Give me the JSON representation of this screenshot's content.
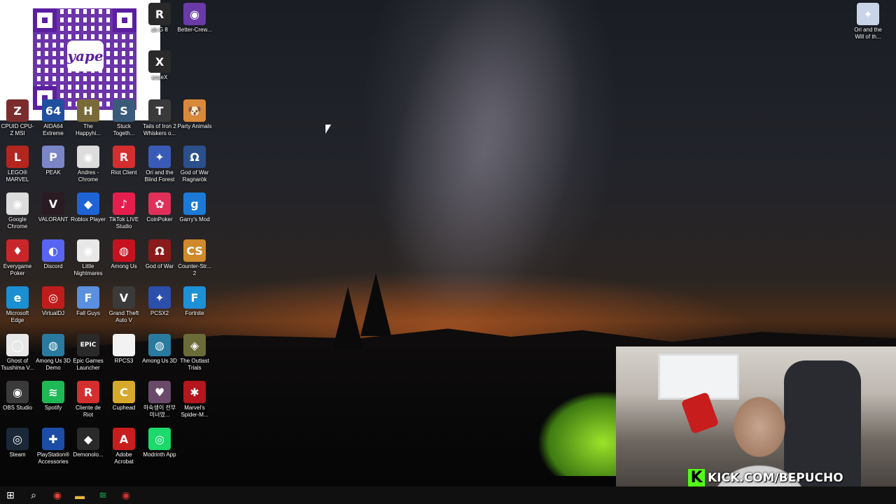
{
  "desktop": {
    "icons": [
      {
        "label": "CPUID CPU-Z MSI",
        "color": "#7b2c2c",
        "glyph": "Z",
        "x": 0,
        "y": 0
      },
      {
        "label": "AIDA64 Extreme",
        "color": "#1f4f9e",
        "glyph": "64"
      },
      {
        "label": "The Happyhi...",
        "color": "#7a6a3a",
        "glyph": "H"
      },
      {
        "label": "Stuck Togeth...",
        "color": "#3a5a7a",
        "glyph": "S"
      },
      {
        "label": "Tails of Iron 2 Whiskers o...",
        "color": "#3a3a3a",
        "glyph": "T"
      },
      {
        "label": "Party Animals",
        "color": "#d9893a",
        "glyph": "🐶"
      },
      {
        "label": "LEGO® MARVEL Su...",
        "color": "#b3261e",
        "glyph": "L"
      },
      {
        "label": "PEAK",
        "color": "#7a86c8",
        "glyph": "P"
      },
      {
        "label": "Andres - Chrome",
        "color": "#dcdcdc",
        "glyph": "◉"
      },
      {
        "label": "Riot Client",
        "color": "#d32f2f",
        "glyph": "R"
      },
      {
        "label": "Ori and the Blind Forest",
        "color": "#3a5bb5",
        "glyph": "✦"
      },
      {
        "label": "God of War Ragnarök",
        "color": "#2b4f8a",
        "glyph": "Ω"
      },
      {
        "label": "Google Chrome",
        "color": "#dcdcdc",
        "glyph": "◉"
      },
      {
        "label": "VALORANT",
        "color": "#2a1a22",
        "glyph": "V"
      },
      {
        "label": "Roblox Player",
        "color": "#1e63d6",
        "glyph": "◆"
      },
      {
        "label": "TikTok LIVE Studio",
        "color": "#e61e4d",
        "glyph": "♪"
      },
      {
        "label": "CoinPoker",
        "color": "#e0305a",
        "glyph": "✿"
      },
      {
        "label": "Garry's Mod",
        "color": "#1c7ad6",
        "glyph": "g"
      },
      {
        "label": "Everygame Poker",
        "color": "#c9262b",
        "glyph": "♦"
      },
      {
        "label": "Discord",
        "color": "#5865f2",
        "glyph": "◐"
      },
      {
        "label": "Little Nightmares",
        "color": "#e8e8e8",
        "glyph": "◉"
      },
      {
        "label": "Among Us",
        "color": "#c5121f",
        "glyph": "◍"
      },
      {
        "label": "God of War",
        "color": "#8b1a1a",
        "glyph": "Ω"
      },
      {
        "label": "Counter-Str... 2",
        "color": "#d08a2b",
        "glyph": "CS"
      },
      {
        "label": "Microsoft Edge",
        "color": "#1a8fd1",
        "glyph": "e"
      },
      {
        "label": "VirtualDJ",
        "color": "#c01c1c",
        "glyph": "◎"
      },
      {
        "label": "Fall Guys",
        "color": "#5b8fe0",
        "glyph": "F"
      },
      {
        "label": "Grand Theft Auto V",
        "color": "#3a3a3a",
        "glyph": "V"
      },
      {
        "label": "PCSX2",
        "color": "#2b4faa",
        "glyph": "✦"
      },
      {
        "label": "Fortnite",
        "color": "#1e90d6",
        "glyph": "F"
      },
      {
        "label": "Ghost of Tsushima V...",
        "color": "#e8e8e8",
        "glyph": "◯"
      },
      {
        "label": "Among Us 3D Demo",
        "color": "#2a7aa0",
        "glyph": "◍"
      },
      {
        "label": "Epic Games Launcher",
        "color": "#2a2a2a",
        "glyph": "EPIC"
      },
      {
        "label": "RPCS3",
        "color": "#f2f2f2",
        "glyph": ""
      },
      {
        "label": "Among Us 3D",
        "color": "#2a7aa0",
        "glyph": "◍"
      },
      {
        "label": "The Outlast Trials",
        "color": "#6b6b3a",
        "glyph": "◈"
      },
      {
        "label": "OBS Studio",
        "color": "#3a3a3a",
        "glyph": "◉"
      },
      {
        "label": "Spotify",
        "color": "#1db954",
        "glyph": "≋"
      },
      {
        "label": "Cliente de Riot",
        "color": "#d32f2f",
        "glyph": "R"
      },
      {
        "label": "Cuphead",
        "color": "#d6a92b",
        "glyph": "C"
      },
      {
        "label": "하숙생이 전부 미녀였...",
        "color": "#6a4a6a",
        "glyph": "♥"
      },
      {
        "label": "Marvel's Spider-M...",
        "color": "#b3161e",
        "glyph": "✱"
      },
      {
        "label": "Steam",
        "color": "#1b2838",
        "glyph": "◎"
      },
      {
        "label": "PlayStation® Accessories",
        "color": "#1c4ea8",
        "glyph": "✚"
      },
      {
        "label": "Demonolo...",
        "color": "#2a2a2a",
        "glyph": "◆"
      },
      {
        "label": "Adobe Acrobat",
        "color": "#c81d1d",
        "glyph": "A"
      },
      {
        "label": "Modrinth App",
        "color": "#1bd96a",
        "glyph": "◎"
      }
    ],
    "top_icons": [
      {
        "label": "ch G 8",
        "color": "#2a2a2a",
        "glyph": "R"
      },
      {
        "label": "Better-Crew...",
        "color": "#6a3aa8",
        "glyph": "◉"
      },
      {
        "label": "enseX",
        "color": "#2a2a2a",
        "glyph": "X"
      }
    ],
    "right_icon": {
      "label": "Ori and the Will of th...",
      "color": "#c9d4e8",
      "glyph": "✦"
    },
    "qr": {
      "logo_text": "yape"
    }
  },
  "taskbar": {
    "items": [
      {
        "name": "start-icon",
        "glyph": "⊞",
        "color": "#ffffff"
      },
      {
        "name": "search-icon",
        "glyph": "⌕",
        "color": "#ffffff"
      },
      {
        "name": "chrome-icon",
        "glyph": "◉",
        "color": "#e0453a"
      },
      {
        "name": "file-explorer-icon",
        "glyph": "▬",
        "color": "#e8b53a"
      },
      {
        "name": "spotify-icon",
        "glyph": "≋",
        "color": "#1db954"
      },
      {
        "name": "riot-icon",
        "glyph": "◉",
        "color": "#d32f2f"
      }
    ]
  },
  "stream": {
    "overlay_text": "KICK.COM/BEPUCHO",
    "logo": "K"
  }
}
